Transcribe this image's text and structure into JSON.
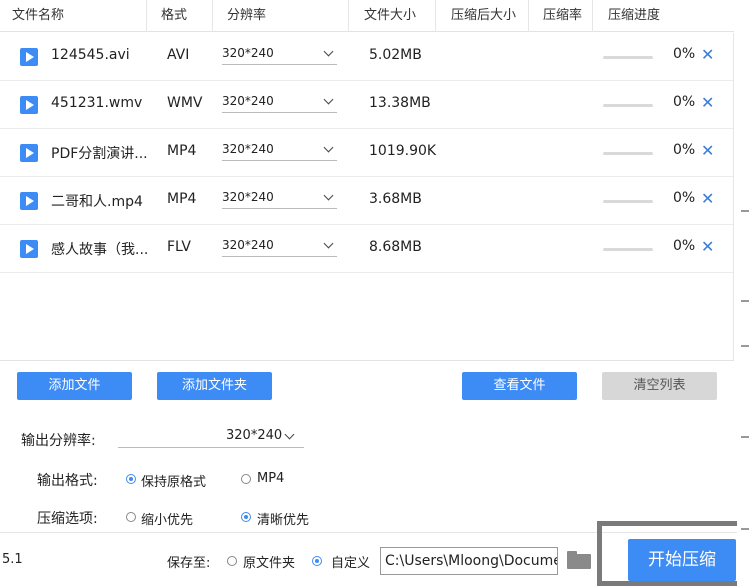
{
  "header": {
    "col_name": "文件名称",
    "col_format": "格式",
    "col_resolution": "分辨率",
    "col_size": "文件大小",
    "col_after": "压缩后大小",
    "col_ratio": "压缩率",
    "col_progress": "压缩进度"
  },
  "files": [
    {
      "name": "124545.avi",
      "format": "AVI",
      "resolution": "320*240",
      "size": "5.02MB",
      "progress": "0%",
      "progress_value": 0
    },
    {
      "name": "451231.wmv",
      "format": "WMV",
      "resolution": "320*240",
      "size": "13.38MB",
      "progress": "0%",
      "progress_value": 0
    },
    {
      "name": "PDF分割演讲...",
      "format": "MP4",
      "resolution": "320*240",
      "size": "1019.90KB",
      "progress": "0%",
      "progress_value": 0
    },
    {
      "name": "二哥和人.mp4",
      "format": "MP4",
      "resolution": "320*240",
      "size": "3.68MB",
      "progress": "0%",
      "progress_value": 0
    },
    {
      "name": "感人故事（我...",
      "format": "FLV",
      "resolution": "320*240",
      "size": "8.68MB",
      "progress": "0%",
      "progress_value": 0
    }
  ],
  "actions": {
    "add_file": "添加文件",
    "add_folder": "添加文件夹",
    "view_file": "查看文件",
    "clear_list": "清空列表"
  },
  "settings": {
    "out_res_label": "输出分辨率:",
    "out_res_value": "320*240",
    "out_fmt_label": "输出格式:",
    "fmt_keep": "保持原格式",
    "fmt_mp4": "MP4",
    "compress_label": "压缩选项:",
    "opt_small": "缩小优先",
    "opt_clear": "清晰优先"
  },
  "footer": {
    "version": "5.1",
    "save_to": "保存至:",
    "save_original": "原文件夹",
    "save_custom": "自定义",
    "path": "C:\\Users\\Mloong\\Documents",
    "start": "开始压缩"
  },
  "colors": {
    "accent": "#3d8bf5",
    "disabled": "#d7d7d7"
  }
}
